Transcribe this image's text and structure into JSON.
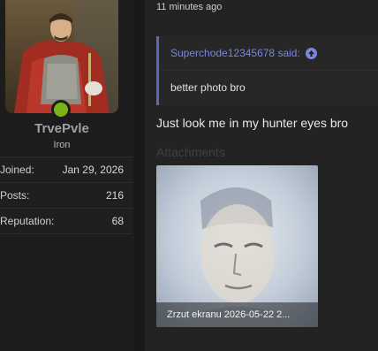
{
  "user": {
    "name": "TrvePvle",
    "title": "Iron",
    "online_color": "#7ab317",
    "stats": [
      {
        "label": "Joined:",
        "value": "Jan 29, 2026"
      },
      {
        "label": "Posts:",
        "value": "216"
      },
      {
        "label": "Reputation:",
        "value": "68"
      }
    ]
  },
  "post": {
    "timestamp": "11 minutes ago",
    "quote": {
      "author_said": "Superchode12345678 said:",
      "text": "better photo bro",
      "icon": "arrow-up-icon"
    },
    "message": "Just look me in my hunter eyes bro",
    "attachments_heading": "Attachments",
    "attachment": {
      "filename": "Zrzut ekranu 2026-05-22 2..."
    }
  },
  "colors": {
    "accent": "#5b67b8",
    "quote_link": "#7a86d8",
    "background": "#1e1e1f"
  }
}
